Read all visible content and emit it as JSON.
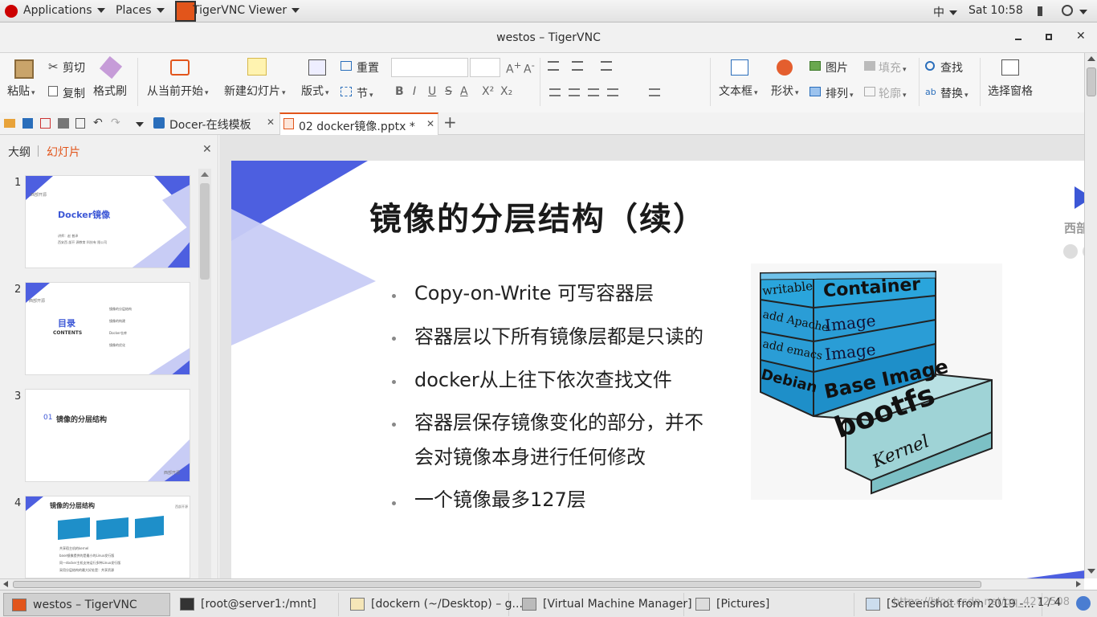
{
  "topbar": {
    "applications": "Applications",
    "places": "Places",
    "app": "TigerVNC Viewer",
    "input_method": "中",
    "clock": "Sat 10:58"
  },
  "window": {
    "title": "westos – TigerVNC"
  },
  "ribbon": {
    "paste": "粘贴",
    "cut": "剪切",
    "copy": "复制",
    "format_painter": "格式刷",
    "from_current": "从当前开始",
    "new_slide": "新建幻灯片",
    "layout": "版式",
    "reset": "重置",
    "section": "节",
    "bold": "B",
    "italic": "I",
    "underline": "U",
    "strike": "S",
    "fontcolor": "A",
    "superscript": "X²",
    "subscript": "X₂",
    "textbox": "文本框",
    "shape": "形状",
    "picture": "图片",
    "fill": "填充",
    "arrange": "排列",
    "outline": "轮廓",
    "find": "查找",
    "replace": "替换",
    "select_pane": "选择窗格"
  },
  "tabs": [
    {
      "label": "Docer-在线模板"
    },
    {
      "label": "02 docker镜像.pptx *"
    }
  ],
  "leftpane": {
    "outline_tab": "大纲",
    "slides_tab": "幻灯片"
  },
  "thumbs": [
    {
      "num": "1",
      "title": "Docker镜像",
      "logo": "西部开源",
      "sub": "讲师：赵 普泽",
      "sub2": "西安西 部开 源教育 科技有 限公司"
    },
    {
      "num": "2",
      "title": "目录",
      "sub": "CONTENTS",
      "logo": "西部开源",
      "items": [
        "镜像的分层结构",
        "镜像的构建",
        "Docker仓库",
        "镜像的优化"
      ]
    },
    {
      "num": "3",
      "sec": "01",
      "title": "镜像的分层结构",
      "logo": "西部开源"
    },
    {
      "num": "4",
      "title": "镜像的分层结构",
      "logo": "西部开源",
      "lines": [
        "共享宿主机的kernel",
        "base镜像提供的是最小的Linux发行版",
        "同一docker主机支持运行多种Linux发行版",
        "采用分层结构的最大好处是：共享资源"
      ]
    }
  ],
  "slide": {
    "title": "镜像的分层结构（续）",
    "bullets": [
      "Copy-on-Write 可写容器层",
      "容器层以下所有镜像层都是只读的",
      "docker从上往下依次查找文件",
      "容器层保存镜像变化的部分，并不",
      "会对镜像本身进行任何修改",
      "一个镜像最多127层"
    ],
    "brand": "西部",
    "diagram": {
      "layers": [
        "writable",
        "Container",
        "add Apache",
        "Image",
        "add emacs",
        "Image",
        "Debian",
        "Base Image",
        "bootfs",
        "Kernel"
      ]
    }
  },
  "taskbar": [
    {
      "label": "westos – TigerVNC"
    },
    {
      "label": "[root@server1:/mnt]"
    },
    {
      "label": "[dockern (~/Desktop) – g..."
    },
    {
      "label": "[Virtual Machine Manager]"
    },
    {
      "label": "[Pictures]"
    },
    {
      "label": "[Screenshot from 2019 -..."
    }
  ],
  "watermark": "https://blog.csdn.net/qq_4272508",
  "page_indicator": "1 / 4"
}
